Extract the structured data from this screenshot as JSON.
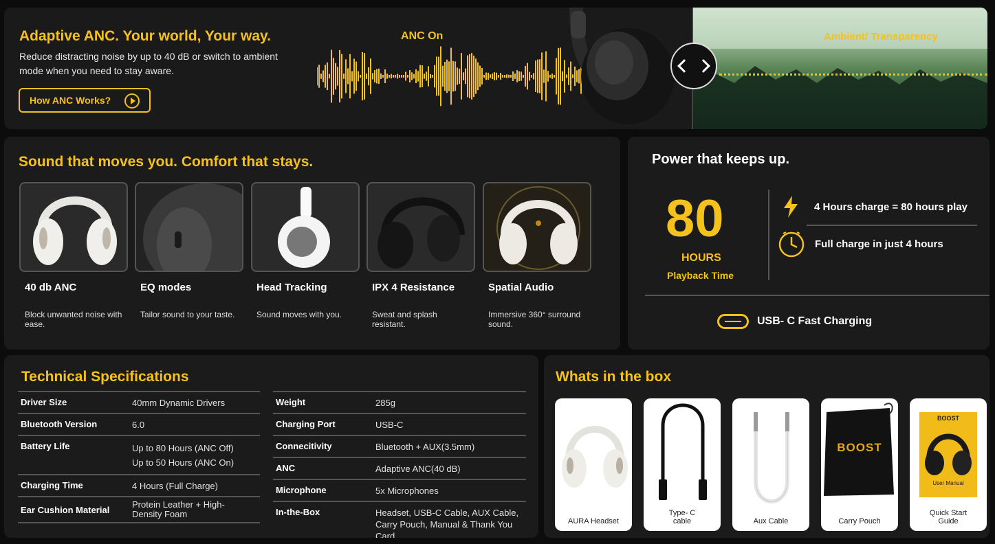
{
  "anc": {
    "title": "Adaptive ANC. Your world, Your way.",
    "description": "Reduce distracting noise by up to 40 dB or switch to ambient mode when you need to stay aware.",
    "button_label": "How ANC Works?",
    "anc_on_label": "ANC On",
    "ambient_label": "Ambient/ Transparency"
  },
  "sound": {
    "title": "Sound that moves you. Comfort that stays.",
    "features": [
      {
        "name": "40 db ANC",
        "desc": "Block unwanted noise with ease."
      },
      {
        "name": "EQ modes",
        "desc": "Tailor sound to your taste."
      },
      {
        "name": "Head Tracking",
        "desc": "Sound moves with you."
      },
      {
        "name": "IPX 4 Resistance",
        "desc": "Sweat and splash resistant."
      },
      {
        "name": "Spatial Audio",
        "desc": "Immersive 360° surround sound."
      }
    ]
  },
  "power": {
    "title": "Power that keeps up.",
    "big_number": "80",
    "hours_label": "HOURS",
    "playback_label": "Playback Time",
    "row1": "4 Hours charge = 80 hours play",
    "row2": "Full charge in just 4 hours",
    "usb_label": "USB- C Fast Charging"
  },
  "spec": {
    "title": "Technical Specifications",
    "left": [
      {
        "label": "Driver Size",
        "value": "40mm Dynamic Drivers"
      },
      {
        "label": "Bluetooth Version",
        "value": "6.0"
      },
      {
        "label": "Battery Life",
        "value": "Up to 80 Hours (ANC Off)\nUp to 50 Hours (ANC On)"
      },
      {
        "label": "Charging Time",
        "value": "4 Hours (Full Charge)"
      },
      {
        "label": "Ear Cushion Material",
        "value": "Protein Leather + High-Density Foam"
      }
    ],
    "right": [
      {
        "label": "Weight",
        "value": "285g"
      },
      {
        "label": "Charging Port",
        "value": "USB-C"
      },
      {
        "label": "Connecitivity",
        "value": "Bluetooth + AUX(3.5mm)"
      },
      {
        "label": "ANC",
        "value": "Adaptive ANC(40 dB)"
      },
      {
        "label": "Microphone",
        "value": "5x Microphones"
      },
      {
        "label": "In-the-Box",
        "value": "Headset, USB-C Cable, AUX Cable, Carry Pouch, Manual & Thank You Card."
      }
    ]
  },
  "box": {
    "title": "Whats in the box",
    "items": [
      {
        "label": "AURA Headset"
      },
      {
        "label": "Type- C cable"
      },
      {
        "label": "Aux Cable"
      },
      {
        "label": "Carry Pouch"
      },
      {
        "label": "Quick Start Guide"
      }
    ],
    "pouch_brand": "BOOST",
    "manual_label": "User Manual",
    "manual_brand": "BOOST"
  },
  "colors": {
    "accent": "#f5c21b",
    "panel": "#1b1b1b",
    "background": "#0c0c0c"
  }
}
